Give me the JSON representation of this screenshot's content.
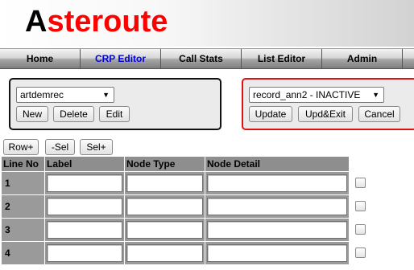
{
  "header": {
    "logo_first": "A",
    "logo_rest": "steroute",
    "logo_colors": {
      "first": "#000000",
      "rest": "#ff0000"
    }
  },
  "nav": {
    "items": [
      {
        "label": "Home",
        "active": false
      },
      {
        "label": "CRP Editor",
        "active": true
      },
      {
        "label": "Call Stats",
        "active": false
      },
      {
        "label": "List Editor",
        "active": false
      },
      {
        "label": "Admin",
        "active": false
      }
    ],
    "active_color": "#0000e6"
  },
  "left_panel": {
    "select_value": "artdemrec",
    "buttons": {
      "new": "New",
      "delete": "Delete",
      "edit": "Edit"
    }
  },
  "right_panel": {
    "select_value": "record_ann2 - INACTIVE",
    "buttons": {
      "update": "Update",
      "upd_exit": "Upd&Exit",
      "cancel": "Cancel"
    },
    "border_color": "#e01010"
  },
  "toolbar": {
    "row_plus": "Row+",
    "sel_minus": "-Sel",
    "sel_plus": "Sel+"
  },
  "table": {
    "headers": {
      "line_no": "Line No",
      "label": "Label",
      "node_type": "Node Type",
      "node_detail": "Node Detail"
    },
    "rows": [
      {
        "line_no": "1",
        "label": "",
        "node_type": "",
        "node_detail": "",
        "selected": false
      },
      {
        "line_no": "2",
        "label": "",
        "node_type": "",
        "node_detail": "",
        "selected": false
      },
      {
        "line_no": "3",
        "label": "",
        "node_type": "",
        "node_detail": "",
        "selected": false
      },
      {
        "line_no": "4",
        "label": "",
        "node_type": "",
        "node_detail": "",
        "selected": false
      }
    ]
  }
}
